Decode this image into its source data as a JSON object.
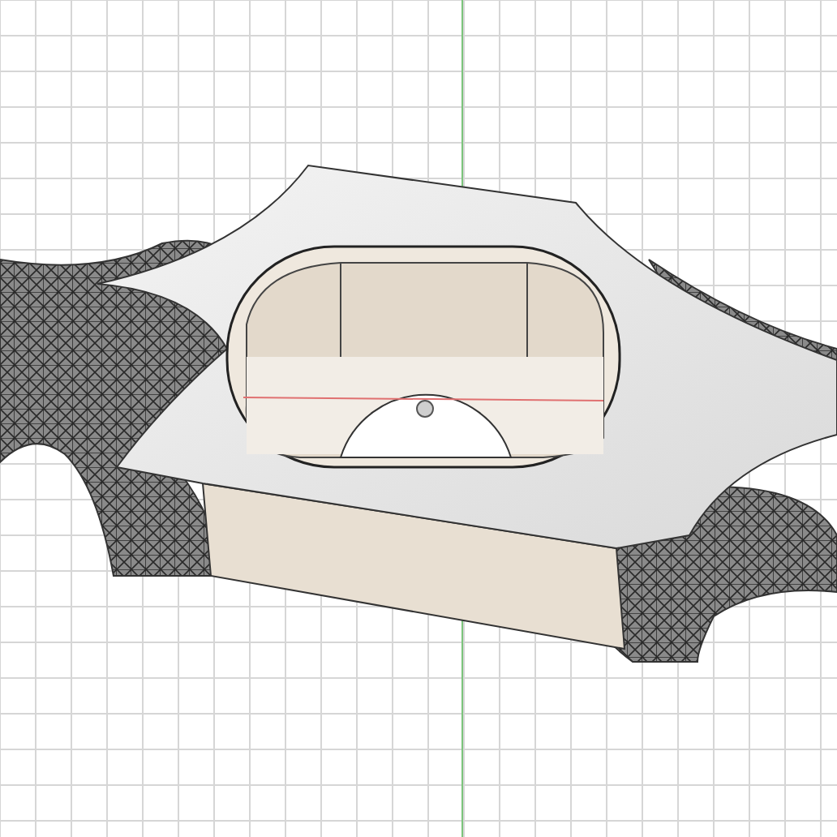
{
  "viewport": {
    "grid": true,
    "origin_axes": true
  }
}
